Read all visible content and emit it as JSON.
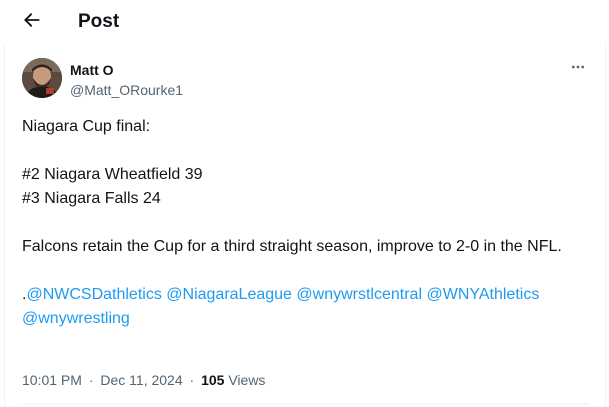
{
  "header": {
    "back_icon": "arrow-left-icon",
    "title": "Post"
  },
  "author": {
    "name": "Matt O",
    "handle": "@Matt_ORourke1",
    "more_icon": "more-horizontal-icon"
  },
  "tweet": {
    "line1": "Niagara Cup final:",
    "line2": "#2 Niagara Wheatfield 39",
    "line3": "#3 Niagara Falls 24",
    "paragraph": "Falcons retain the Cup for a third straight season, improve to 2-0 in the NFL.",
    "mention_prefix": ".",
    "mentions": [
      "@NWCSDathletics",
      "@NiagaraLeague",
      "@wnywrstlcentral",
      "@WNYAthletics",
      "@wnywrestling"
    ]
  },
  "meta": {
    "time": "10:01 PM",
    "separator": "·",
    "date": "Dec 11, 2024",
    "views_count": "105",
    "views_label": "Views"
  },
  "colors": {
    "link": "#1d9bf0",
    "text": "#0f1419",
    "secondary": "#536471"
  }
}
